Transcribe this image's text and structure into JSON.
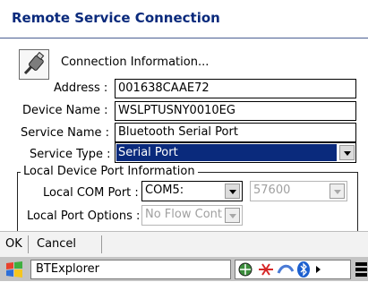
{
  "window": {
    "title": "Remote Service Connection"
  },
  "header": {
    "label": "Connection Information..."
  },
  "fields": {
    "address": {
      "label": "Address :",
      "value": "001638CAAE72"
    },
    "device_name": {
      "label": "Device Name :",
      "value": "WSLPTUSNY0010EG"
    },
    "service_name": {
      "label": "Service Name :",
      "value": "Bluetooth Serial Port"
    },
    "service_type": {
      "label": "Service Type :",
      "value": "Serial Port"
    }
  },
  "local_port": {
    "group_label": "Local Device Port Information",
    "com_port": {
      "label": "Local COM Port :",
      "value": "COM5:"
    },
    "baud": {
      "value": "57600"
    },
    "options": {
      "label": "Local Port Options :",
      "value": "No Flow Cont"
    }
  },
  "menu": {
    "ok": "OK",
    "cancel": "Cancel"
  },
  "taskbar": {
    "app": "BTExplorer"
  },
  "colors": {
    "title_text": "#0a2a7c",
    "selection": "#0a2a7c",
    "taskbar": "#c4c4c4"
  }
}
